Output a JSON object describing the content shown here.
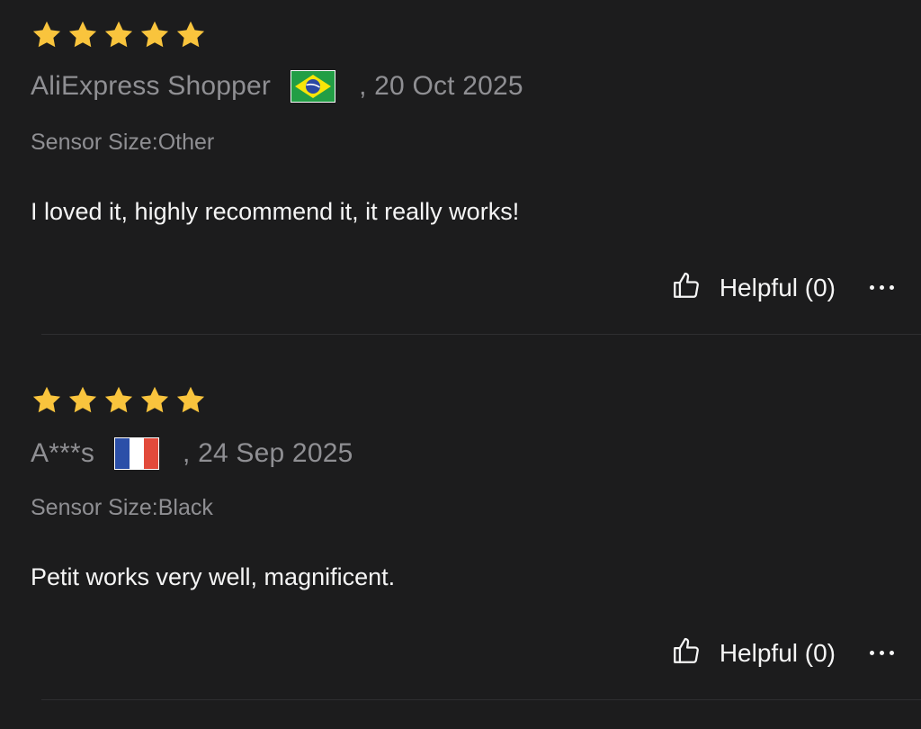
{
  "colors": {
    "background": "#1c1c1d",
    "star": "#f9c43d",
    "muted_text": "#8f8f93",
    "primary_text": "#f5f5f5",
    "divider": "#2e2e30"
  },
  "reviews": [
    {
      "rating": 5,
      "author": "AliExpress Shopper",
      "flag_icon": "brazil-flag-icon",
      "date": ", 20 Oct 2025",
      "variant": "Sensor Size:Other",
      "text": "I loved it, highly recommend it, it really works!",
      "helpful_label": "Helpful (0)",
      "helpful_icon": "thumbs-up-icon",
      "more_icon": "more-options-icon"
    },
    {
      "rating": 5,
      "author": "A***s",
      "flag_icon": "france-flag-icon",
      "date": ", 24 Sep 2025",
      "variant": "Sensor Size:Black",
      "text": "Petit works very well, magnificent.",
      "helpful_label": "Helpful (0)",
      "helpful_icon": "thumbs-up-icon",
      "more_icon": "more-options-icon"
    }
  ]
}
